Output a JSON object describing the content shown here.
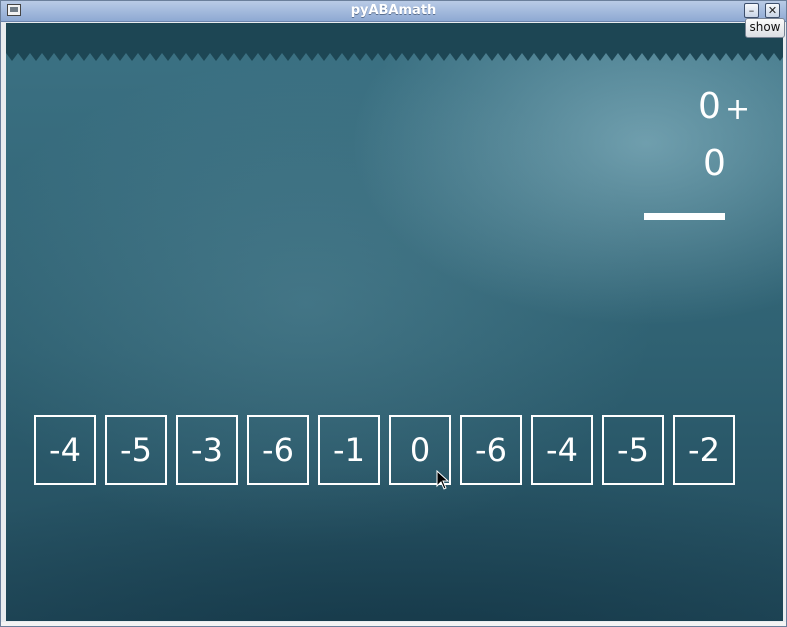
{
  "window": {
    "title": "pyABAmath"
  },
  "toolbar": {
    "show_label": "show"
  },
  "problem": {
    "top_number": "0",
    "operator": "+",
    "bottom_number": "0"
  },
  "answers": [
    "-4",
    "-5",
    "-3",
    "-6",
    "-1",
    "0",
    "-6",
    "-4",
    "-5",
    "-2"
  ],
  "colors": {
    "board": "#2f6172",
    "chalk": "#ffffff",
    "titlebar": "#8ea9d3"
  },
  "icons": [
    "app-icon",
    "minimize-icon",
    "close-icon",
    "mouse-pointer-icon"
  ]
}
